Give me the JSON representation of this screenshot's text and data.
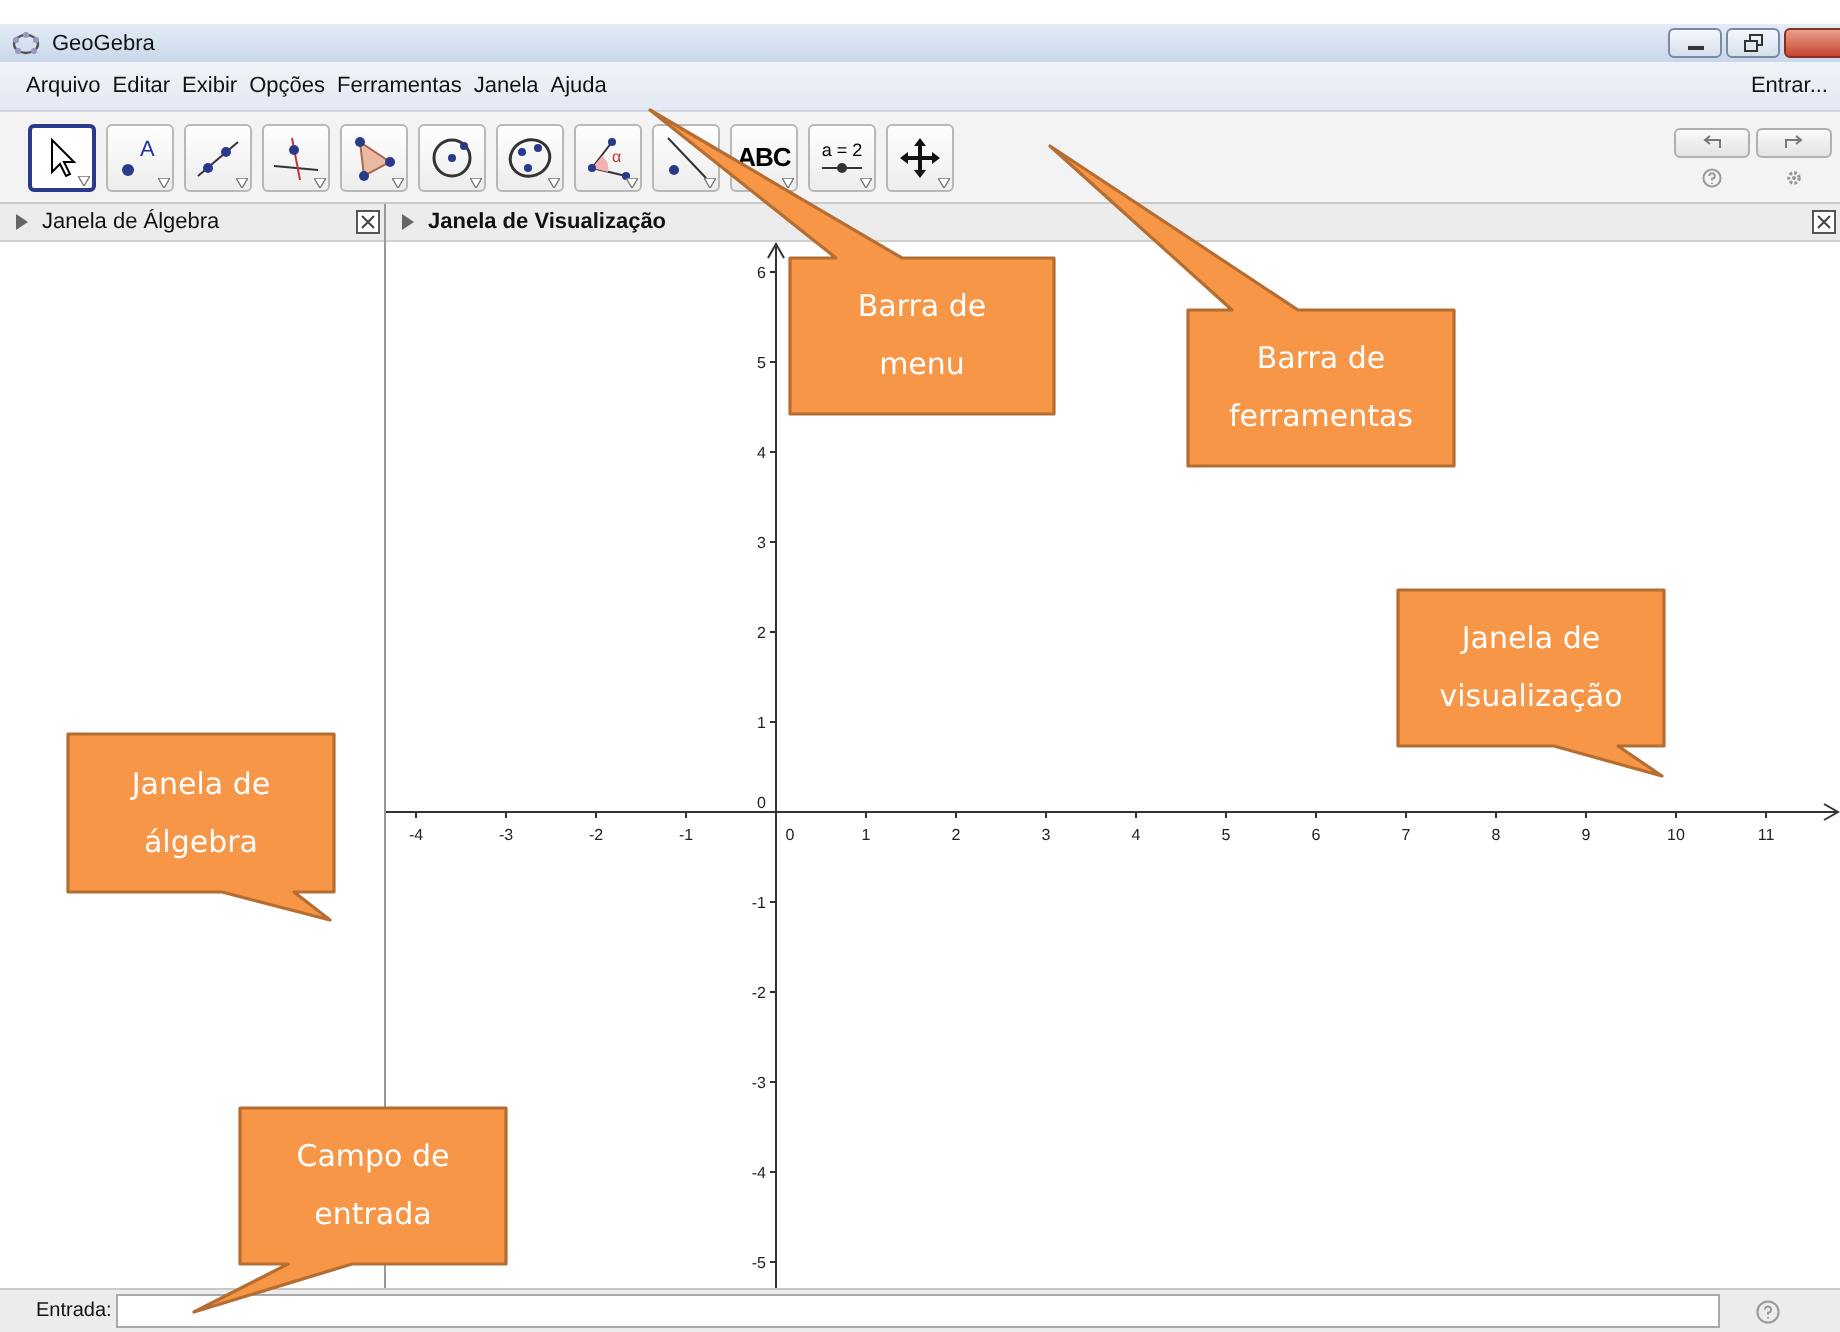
{
  "window": {
    "title": "GeoGebra"
  },
  "menu": {
    "items": [
      "Arquivo",
      "Editar",
      "Exibir",
      "Opções",
      "Ferramentas",
      "Janela",
      "Ajuda"
    ],
    "login": "Entrar..."
  },
  "toolbar": {
    "tools": [
      {
        "kind": "move",
        "selected": true
      },
      {
        "kind": "point",
        "selected": false,
        "label": "A"
      },
      {
        "kind": "line",
        "selected": false
      },
      {
        "kind": "perpendicular",
        "selected": false
      },
      {
        "kind": "polygon",
        "selected": false
      },
      {
        "kind": "circle",
        "selected": false
      },
      {
        "kind": "conic",
        "selected": false
      },
      {
        "kind": "angle",
        "selected": false,
        "label": "α"
      },
      {
        "kind": "reflect",
        "selected": false
      },
      {
        "kind": "text",
        "selected": false,
        "label": "ABC"
      },
      {
        "kind": "slider",
        "selected": false,
        "label": "a = 2"
      },
      {
        "kind": "pan",
        "selected": false
      }
    ]
  },
  "algebra_view": {
    "title": "Janela de Álgebra"
  },
  "graphics_view": {
    "title": "Janela de Visualização",
    "x_axis_labels": [
      "-4",
      "-3",
      "-2",
      "-1",
      "0",
      "1",
      "2",
      "3",
      "4",
      "5",
      "6",
      "7",
      "8",
      "9",
      "10",
      "11"
    ],
    "y_axis_labels": [
      "6",
      "5",
      "4",
      "3",
      "2",
      "1",
      "0",
      "-1",
      "-2",
      "-3",
      "-4",
      "-5"
    ]
  },
  "input_bar": {
    "label": "Entrada:"
  },
  "callouts": [
    {
      "text": "Barra de\nmenu"
    },
    {
      "text": "Barra de\nferramentas"
    },
    {
      "text": "Janela de\nvisualização"
    },
    {
      "text": "Janela de\nálgebra"
    },
    {
      "text": "Campo de\nentrada"
    }
  ]
}
